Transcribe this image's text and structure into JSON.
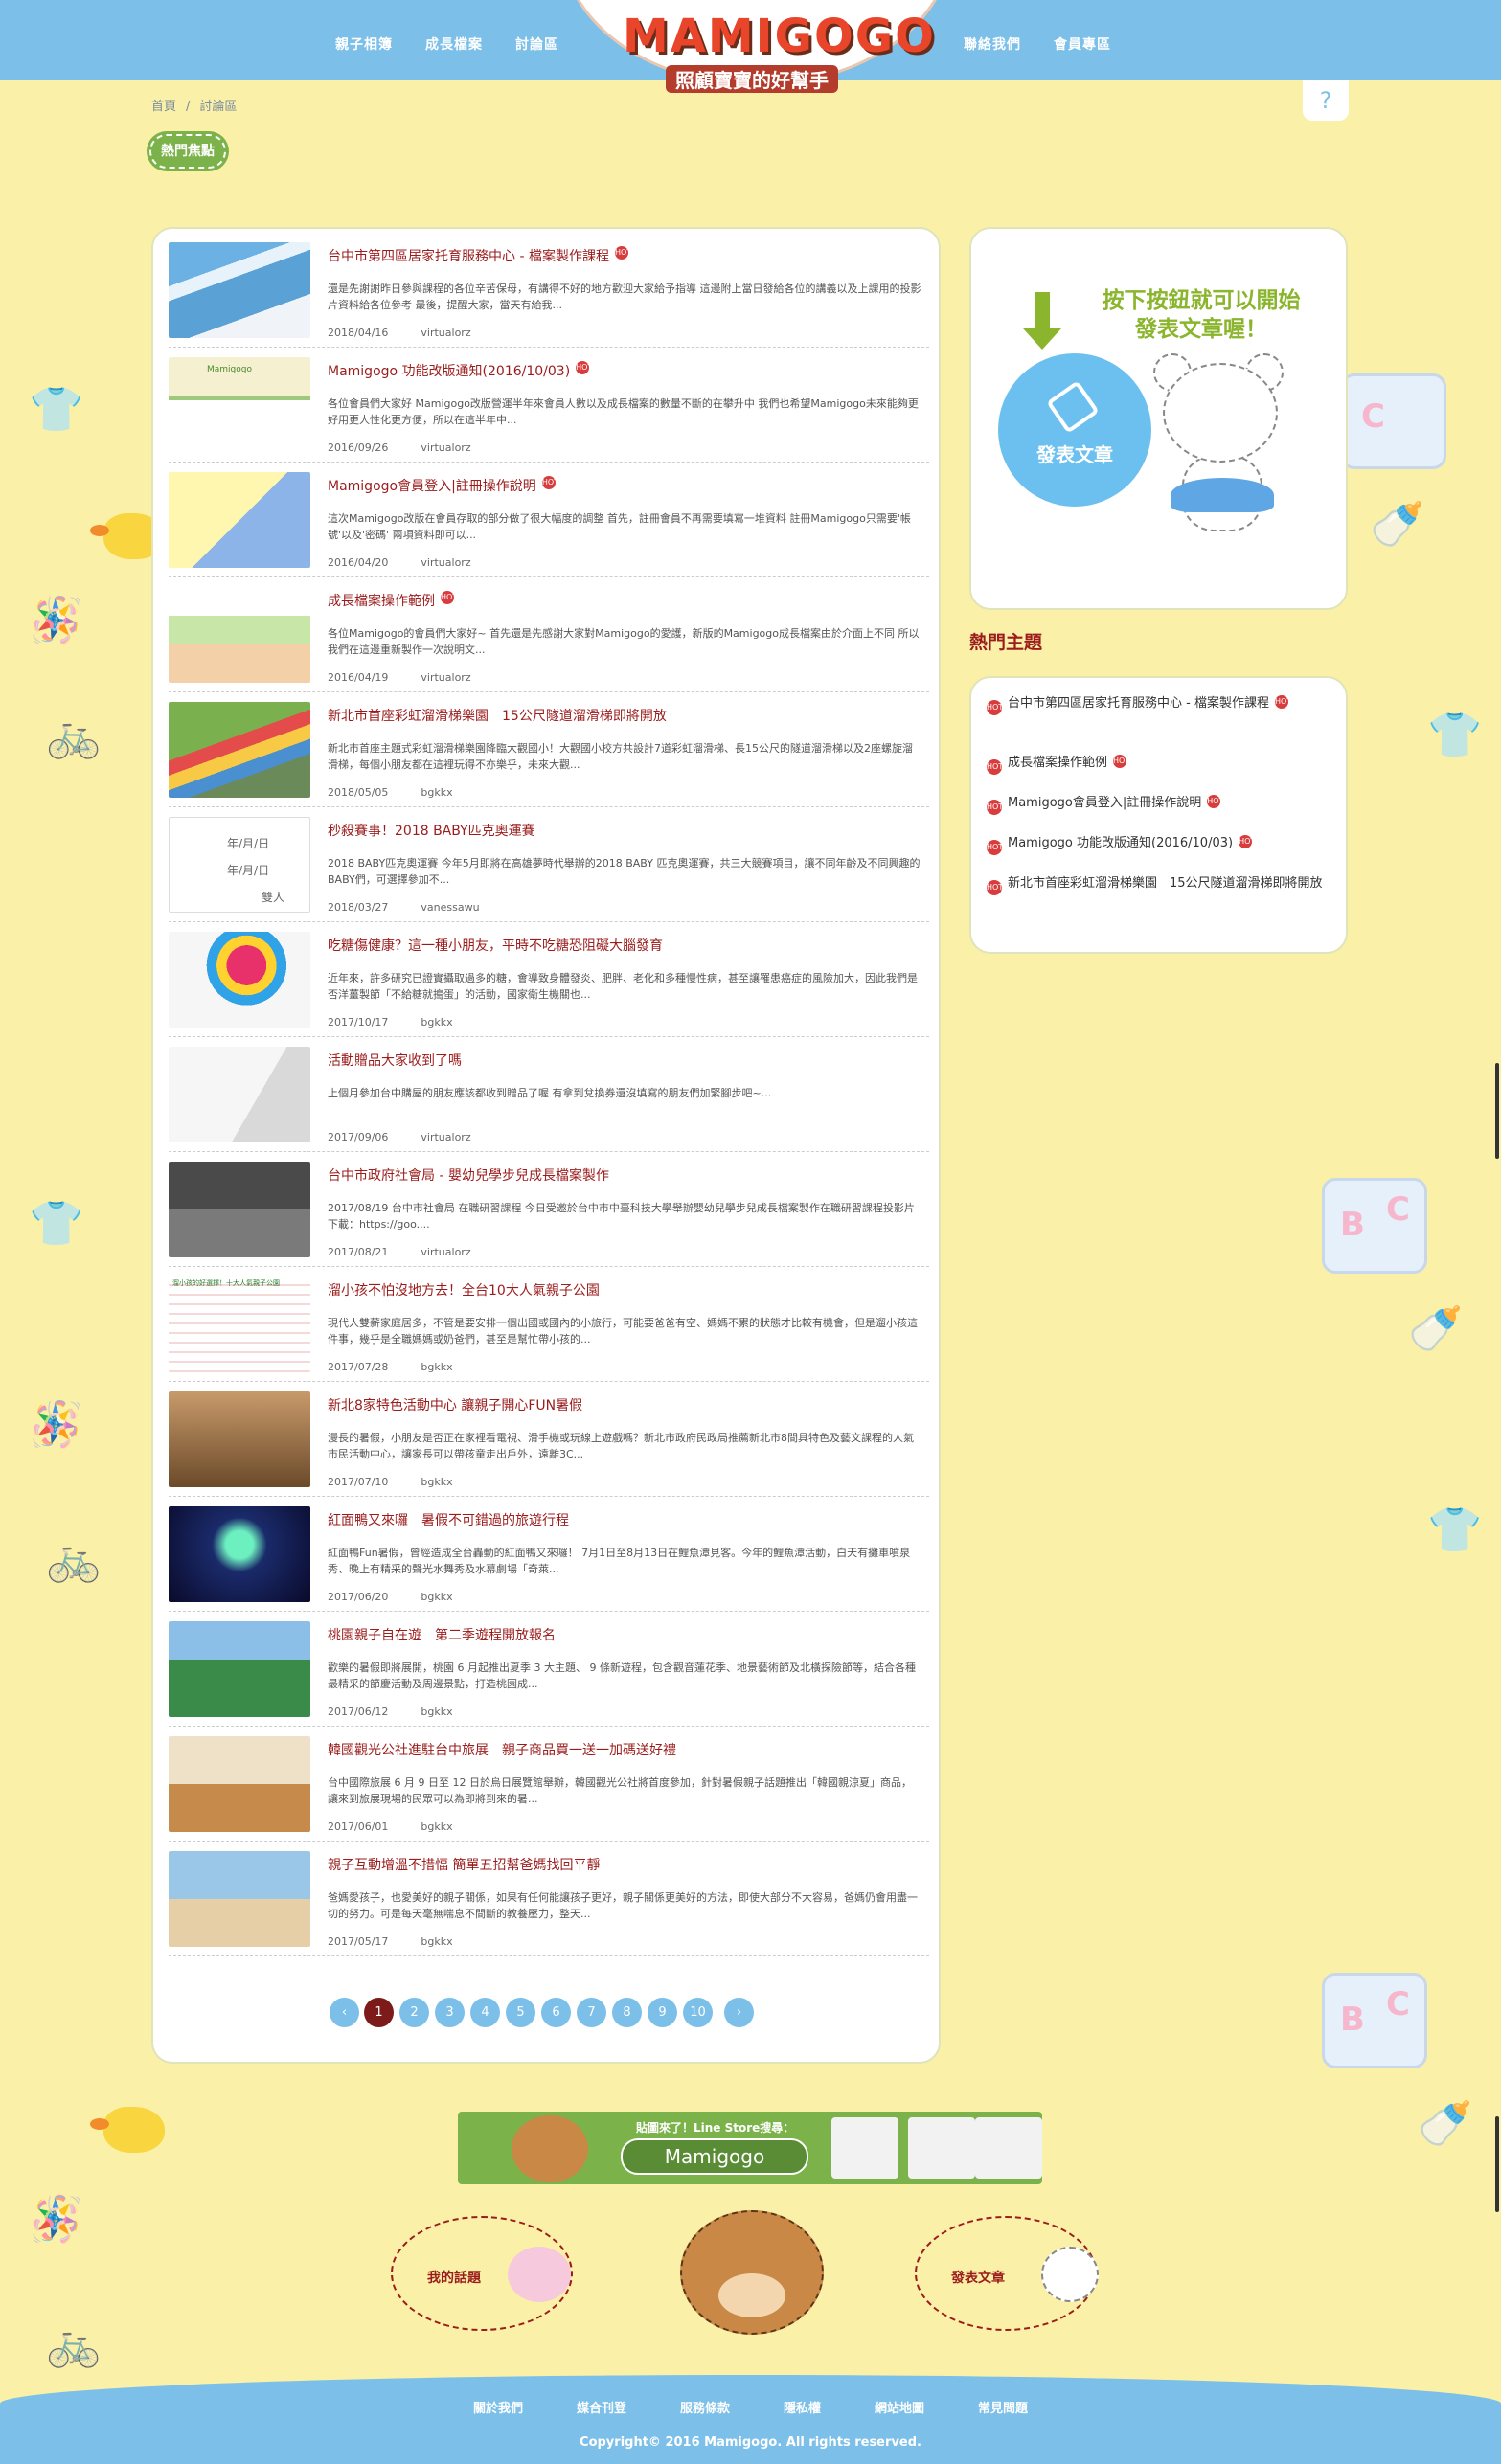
{
  "header": {
    "nav_left": [
      "親子相簿",
      "成長檔案",
      "討論區"
    ],
    "nav_right": [
      "聯絡我們",
      "會員專區"
    ],
    "brand": "MAMIGOGO",
    "slogan": "照顧寶寶的好幫手"
  },
  "breadcrumb": {
    "home": "首頁",
    "sep": "/",
    "current": "討論區"
  },
  "help_label": "?",
  "hot_tab_label": "熱門焦點",
  "hot_icon_text": "HOT",
  "posts": [
    {
      "title": "台中市第四區居家托育服務中心 - 檔案製作課程",
      "hot": true,
      "excerpt": "還是先謝謝昨日參與課程的各位辛苦保母，有講得不好的地方歡迎大家給予指導 這邊附上當日發給各位的講義以及上課用的投影片資料給各位參考 最後，提醒大家，當天有給我...",
      "date": "2018/04/16",
      "author": "virtualorz"
    },
    {
      "title": "Mamigogo 功能改版通知(2016/10/03)",
      "hot": true,
      "excerpt": "各位會員們大家好 Mamigogo改版營運半年來會員人數以及成長檔案的數量不斷的在攀升中 我們也希望Mamigogo未來能夠更好用更人性化更方便，所以在這半年中...",
      "date": "2016/09/26",
      "author": "virtualorz"
    },
    {
      "title": "Mamigogo會員登入|註冊操作說明",
      "hot": true,
      "excerpt": "這次Mamigogo改版在會員存取的部分做了很大幅度的調整 首先，註冊會員不再需要填寫一堆資料 註冊Mamigogo只需要'帳號'以及'密碼' 兩項資料即可以...",
      "date": "2016/04/20",
      "author": "virtualorz"
    },
    {
      "title": "成長檔案操作範例",
      "hot": true,
      "excerpt": "各位Mamigogo的會員們大家好~ 首先還是先感謝大家對Mamigogo的愛護，新版的Mamigogo成長檔案由於介面上不同 所以我們在這邊重新製作一次說明文...",
      "date": "2016/04/19",
      "author": "virtualorz"
    },
    {
      "title": "新北市首座彩虹溜滑梯樂園　15公尺隧道溜滑梯即將開放",
      "hot": false,
      "excerpt": "新北市首座主題式彩虹溜滑梯樂園降臨大觀國小！大觀國小校方共設計7道彩虹溜滑梯、長15公尺的隧道溜滑梯以及2座螺旋溜滑梯，每個小朋友都在這裡玩得不亦樂乎，未來大觀...",
      "date": "2018/05/05",
      "author": "bgkkx"
    },
    {
      "title": "秒殺賽事！2018 BABY匹克奧運賽",
      "hot": false,
      "excerpt": "2018 BABY匹克奧運賽 今年5月即將在高雄夢時代舉辦的2018 BABY 匹克奧運賽，共三大競賽項目，讓不同年齡及不同興趣的BABY們，可選擇參加不...",
      "date": "2018/03/27",
      "author": "vanessawu"
    },
    {
      "title": "吃糖傷健康？這一種小朋友，平時不吃糖恐阻礙大腦發育",
      "hot": false,
      "excerpt": "近年來，許多研究已證實攝取過多的糖，會導致身體發炎、肥胖、老化和多種慢性病，甚至讓罹患癌症的風險加大，因此我們是否洋薑製節「不給糖就搗蛋」的活動，國家衛生機關也...",
      "date": "2017/10/17",
      "author": "bgkkx"
    },
    {
      "title": "活動贈品大家收到了嗎",
      "hot": false,
      "excerpt": "上個月參加台中購屋的朋友應該都收到贈品了喔 有拿到兌換券還沒填寫的朋友們加緊腳步吧~...",
      "date": "2017/09/06",
      "author": "virtualorz"
    },
    {
      "title": "台中市政府社會局 - 嬰幼兒學步兒成長檔案製作",
      "hot": false,
      "excerpt": "2017/08/19 台中市社會局 在職研習課程 今日受邀於台中市中臺科技大學舉辦嬰幼兒學步兒成長檔案製作在職研習課程投影片下載：https://goo....",
      "date": "2017/08/21",
      "author": "virtualorz"
    },
    {
      "title": "溜小孩不怕沒地方去！全台10大人氣親子公園",
      "hot": false,
      "excerpt": "現代人雙薪家庭居多，不管是要安排一個出國或國內的小旅行，可能要爸爸有空、媽媽不累的狀態才比較有機會，但是遛小孩這件事，幾乎是全職媽媽或奶爸們，甚至是幫忙帶小孩的...",
      "date": "2017/07/28",
      "author": "bgkkx"
    },
    {
      "title": "新北8家特色活動中心 讓親子開心FUN暑假",
      "hot": false,
      "excerpt": "漫長的暑假，小朋友是否正在家裡看電視、滑手機或玩線上遊戲嗎？新北市政府民政局推薦新北市8間具特色及藝文課程的人氣市民活動中心，讓家長可以帶孩童走出戶外，遠離3C...",
      "date": "2017/07/10",
      "author": "bgkkx"
    },
    {
      "title": "紅面鴨又來囉　暑假不可錯過的旅遊行程",
      "hot": false,
      "excerpt": "紅面鴨Fun暑假，曾經造成全台轟動的紅面鴨又來囉！ 7月1日至8月13日在鯉魚潭見客。今年的鯉魚潭活動，白天有攤車噴泉秀、晚上有精采的聲光水舞秀及水幕劇場「奇萊...",
      "date": "2017/06/20",
      "author": "bgkkx"
    },
    {
      "title": "桃園親子自在遊　第二季遊程開放報名",
      "hot": false,
      "excerpt": "歡樂的暑假即將展開，桃園 6 月起推出夏季 3 大主題、 9 條新遊程，包含觀音蓮花季、地景藝術節及北橫探險節等，結合各種最精采的節慶活動及周邊景點，打造桃園成...",
      "date": "2017/06/12",
      "author": "bgkkx"
    },
    {
      "title": "韓國觀光公社進駐台中旅展　親子商品買一送一加碼送好禮",
      "hot": false,
      "excerpt": "台中國際旅展 6 月 9 日至 12 日於烏日展覽館舉辦，韓國觀光公社將首度參加，針對暑假親子話題推出「韓國親涼夏」商品，讓來到旅展現場的民眾可以為即將到來的暑...",
      "date": "2017/06/01",
      "author": "bgkkx"
    },
    {
      "title": "親子互動增溫不措愊 簡單五招幫爸媽找回平靜",
      "hot": false,
      "excerpt": "爸媽愛孩子，也愛美好的親子關係，如果有任何能讓孩子更好，親子關係更美好的方法，即使大部分不大容易，爸媽仍會用盡一切的努力。可是每天毫無喘息不間斷的教養壓力，整天...",
      "date": "2017/05/17",
      "author": "bgkkx"
    }
  ],
  "thumb_text": {
    "p2_banner": "Mamigogo",
    "p6_line1": "年/月/日",
    "p6_line2": "年/月/日",
    "p6_line3": "雙人",
    "p10_title": "溜小孩的好選擇！十大人氣親子公園"
  },
  "pagination": {
    "prev": "‹",
    "pages": [
      "1",
      "2",
      "3",
      "4",
      "5",
      "6",
      "7",
      "8",
      "9",
      "10"
    ],
    "next": "›",
    "current": "1"
  },
  "sidebar": {
    "cta_text": "按下按鈕就可以開始發表文章喔！",
    "post_button": "發表文章",
    "hot_topics_heading": "熱門主題",
    "topics": [
      "台中市第四區居家托育服務中心 - 檔案製作課程",
      "成長檔案操作範例",
      "Mamigogo會員登入|註冊操作說明",
      "Mamigogo 功能改版通知(2016/10/03)",
      "新北市首座彩虹溜滑梯樂園　15公尺隧道溜滑梯即將開放"
    ],
    "topic_hot": [
      true,
      true,
      true,
      true,
      false
    ]
  },
  "banner": {
    "title": "貼圖來了！Line Store搜尋：",
    "search": "Mamigogo"
  },
  "bottom": {
    "my_topics": "我的話題",
    "post_article": "發表文章"
  },
  "footer": {
    "links": [
      "關於我們",
      "媒合刊登",
      "服務條款",
      "隱私權",
      "網站地圖",
      "常見問題"
    ],
    "copyright": "Copyright© 2016 Mamigogo. All rights reserved."
  },
  "colors": {
    "header_blue": "#7cc0ea",
    "page_bg": "#fbf0a8",
    "title_red": "#9b1c1c",
    "accent_green": "#7bb34a"
  }
}
